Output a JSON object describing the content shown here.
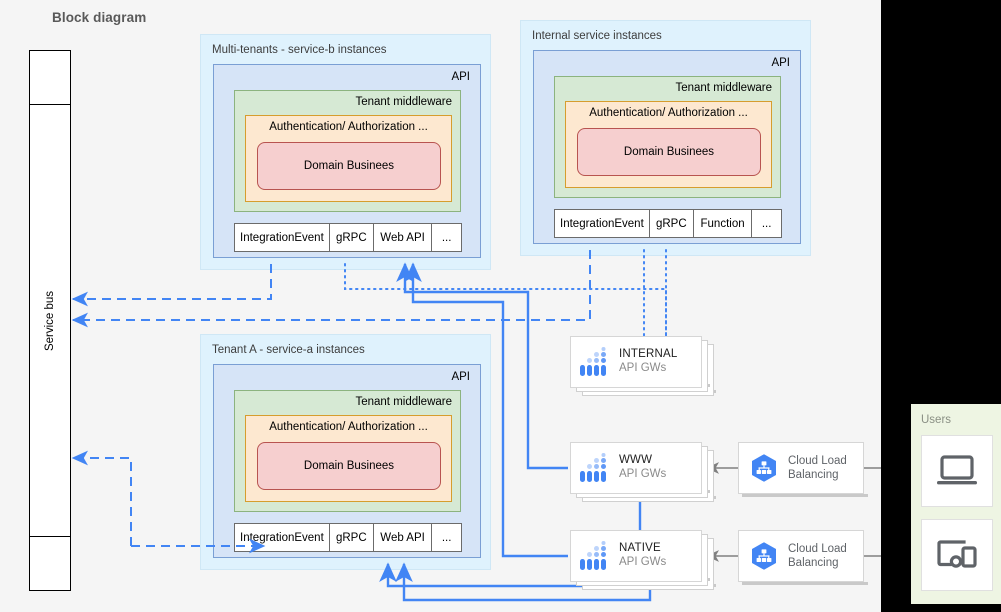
{
  "title": "Block diagram",
  "colors": {
    "accent_blue": "#4285f4",
    "group_bg": "#dff2fd",
    "api_bg": "#d6e4f7",
    "middleware_bg": "#d6e9d4",
    "auth_bg": "#fde8d0",
    "domain_bg": "#f6cfcf",
    "users_bg": "#eef5e3",
    "arrow_gray": "#808080",
    "canvas_bg": "#f5f5f5"
  },
  "service_bus": {
    "label": "Service  bus",
    "segments": 3
  },
  "groups": [
    {
      "id": "multi_tenant_b",
      "title": "Multi-tenants - service-b instances",
      "api_label": "API",
      "middleware_label": "Tenant middleware",
      "auth_label": "Authentication/ Authorization ...",
      "domain_label": "Domain Businees",
      "cells": [
        "IntegrationEvent",
        "gRPC",
        "Web API",
        "..."
      ]
    },
    {
      "id": "internal_services",
      "title": "Internal service instances",
      "api_label": "API",
      "middleware_label": "Tenant middleware",
      "auth_label": "Authentication/ Authorization ...",
      "domain_label": "Domain Businees",
      "cells": [
        "IntegrationEvent",
        "gRPC",
        "Function",
        "..."
      ]
    },
    {
      "id": "tenant_a",
      "title": "Tenant A - service-a instances",
      "api_label": "API",
      "middleware_label": "Tenant middleware",
      "auth_label": "Authentication/ Authorization ...",
      "domain_label": "Domain Businees",
      "cells": [
        "IntegrationEvent",
        "gRPC",
        "Web API",
        "..."
      ]
    }
  ],
  "gateways": [
    {
      "id": "internal_gw",
      "name": "INTERNAL",
      "sub": "API GWs"
    },
    {
      "id": "www_gw",
      "name": "WWW",
      "sub": "API GWs"
    },
    {
      "id": "native_gw",
      "name": "NATIVE",
      "sub": "API GWs"
    }
  ],
  "load_balancers": [
    {
      "id": "clb_www",
      "line1": "Cloud Load",
      "line2": "Balancing"
    },
    {
      "id": "clb_native",
      "line1": "Cloud Load",
      "line2": "Balancing"
    }
  ],
  "users": {
    "title": "Users",
    "devices": [
      {
        "id": "desktop",
        "icon": "laptop-icon"
      },
      {
        "id": "mobile",
        "icon": "devices-icon"
      }
    ]
  }
}
